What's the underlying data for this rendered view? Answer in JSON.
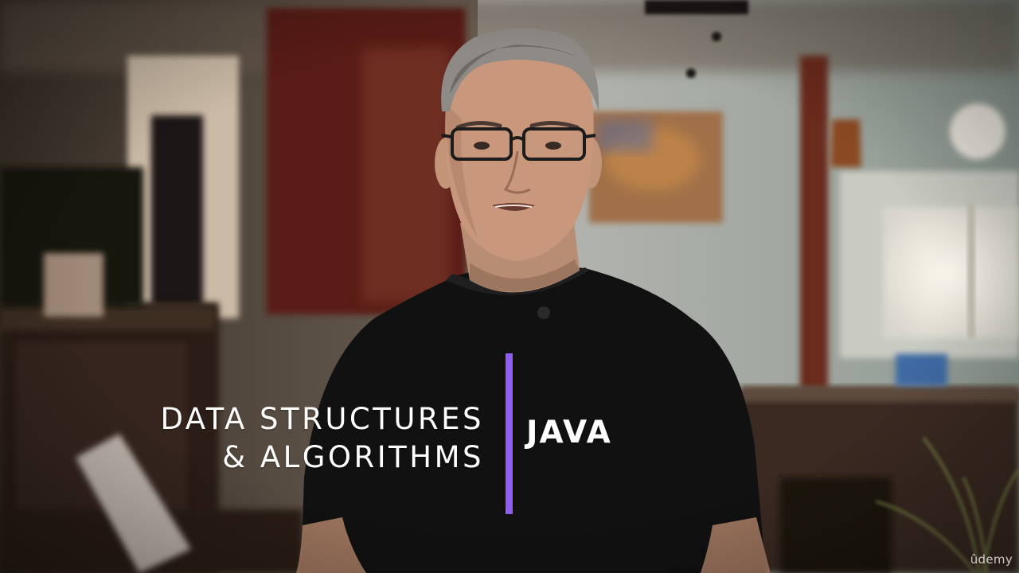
{
  "title": {
    "line1": "DATA STRUCTURES",
    "line2": "& ALGORITHMS",
    "language": "JAVA",
    "accent_color": "#8f5ef0"
  },
  "watermark": {
    "text": "ûdemy"
  }
}
